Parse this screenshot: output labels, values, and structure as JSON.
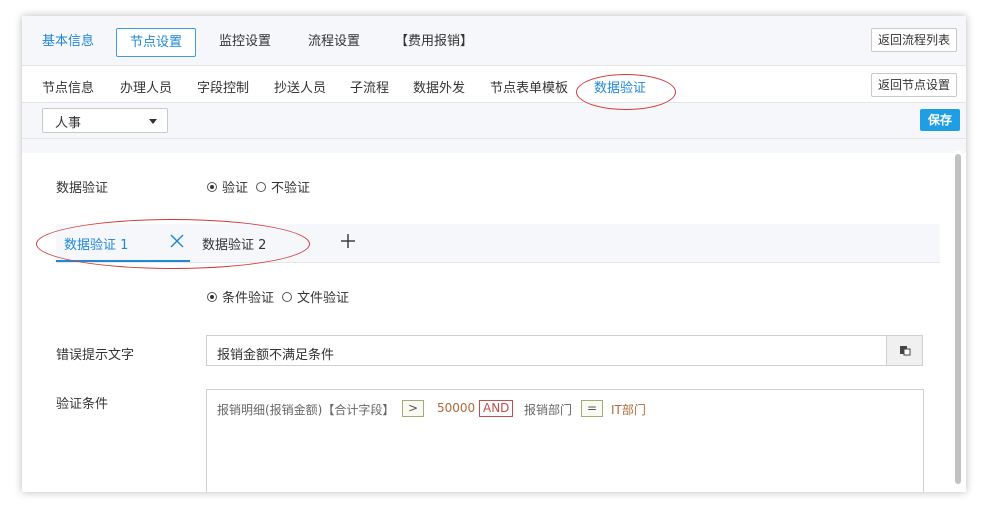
{
  "top_tabs": [
    {
      "label": "基本信息"
    },
    {
      "label": "节点设置"
    },
    {
      "label": "监控设置"
    },
    {
      "label": "流程设置"
    },
    {
      "label": "【费用报销】"
    }
  ],
  "back_to_flow_list": "返回流程列表",
  "sub_tabs": [
    {
      "label": "节点信息"
    },
    {
      "label": "办理人员"
    },
    {
      "label": "字段控制"
    },
    {
      "label": "抄送人员"
    },
    {
      "label": "子流程"
    },
    {
      "label": "数据外发"
    },
    {
      "label": "节点表单模板"
    },
    {
      "label": "数据验证"
    }
  ],
  "back_to_node_settings": "返回节点设置",
  "dept_select": "人事",
  "save_label": "保存",
  "validation": {
    "label": "数据验证",
    "options": [
      "验证",
      "不验证"
    ],
    "selected": "验证"
  },
  "validation_tabs": [
    {
      "label": "数据验证 1"
    },
    {
      "label": "数据验证 2"
    }
  ],
  "validation_type": {
    "options": [
      "条件验证",
      "文件验证"
    ],
    "selected": "条件验证"
  },
  "error_text": {
    "label": "错误提示文字",
    "value": "报销金额不满足条件"
  },
  "condition": {
    "label": "验证条件",
    "tokens": [
      {
        "text": "报销明细(报销金额)【合计字段】",
        "kind": "field"
      },
      {
        "text": ">",
        "kind": "op"
      },
      {
        "text": "50000",
        "kind": "value"
      },
      {
        "text": "AND",
        "kind": "logic"
      },
      {
        "text": "报销部门",
        "kind": "field"
      },
      {
        "text": "=",
        "kind": "op"
      },
      {
        "text": "IT部门",
        "kind": "value"
      }
    ]
  },
  "colors": {
    "accent": "#1f88d8",
    "save_button": "#1f9ee3",
    "annotation": "#d23b3b",
    "and_token": "#c0504d"
  }
}
